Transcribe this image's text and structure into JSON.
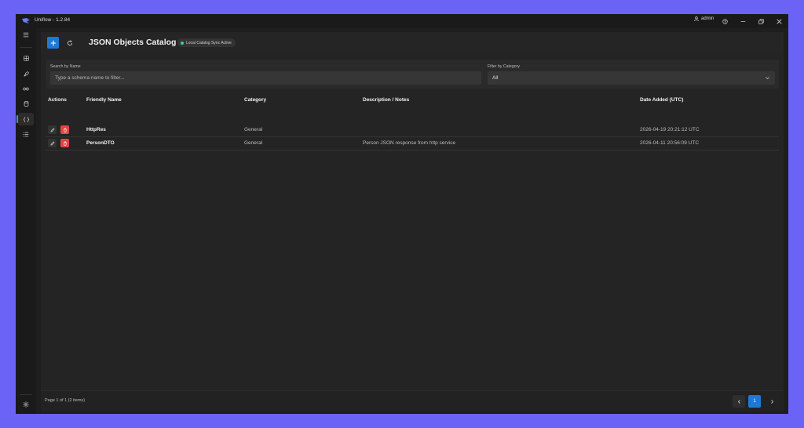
{
  "app": {
    "title": "Uniflow - 1.2.84",
    "user": "admin"
  },
  "sidebar": {
    "items": [
      "menu-icon",
      "dashboard-icon",
      "rocket-icon",
      "integrations-icon",
      "database-icon",
      "json-braces-icon",
      "list-icon"
    ],
    "settings": "settings-icon"
  },
  "toolbar": {
    "title": "JSON Objects Catalog",
    "sync_status": "Local Catalog Sync Active"
  },
  "filters": {
    "search_label": "Search by Name",
    "search_placeholder": "Type a schema name to filter...",
    "category_label": "Filter by Category",
    "category_value": "All"
  },
  "table": {
    "headers": [
      "Actions",
      "Friendly Name",
      "Category",
      "Description / Notes",
      "Date Added (UTC)"
    ],
    "rows": [
      {
        "name": "HttpRes",
        "category": "General",
        "description": "",
        "date": "2026-04-19 20:21:12 UTC"
      },
      {
        "name": "PersonDTO",
        "category": "General",
        "description": "Person JSON response from http service",
        "date": "2026-04-11 20:56:09 UTC"
      }
    ]
  },
  "footer": {
    "page_info": "Page 1 of 1 (2 items)",
    "current_page": "1"
  },
  "colors": {
    "accent": "#1e78d6",
    "danger": "#e04545",
    "sync": "#3ecf8e",
    "background": "#6b63f5"
  }
}
